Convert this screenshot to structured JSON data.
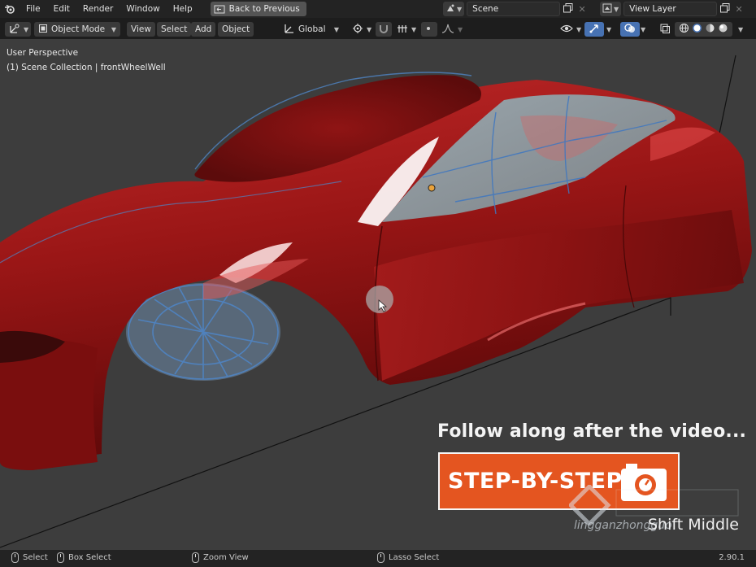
{
  "menu": {
    "items": [
      "File",
      "Edit",
      "Render",
      "Window",
      "Help"
    ],
    "back_button": "Back to Previous"
  },
  "scene": {
    "name": "Scene",
    "view_layer": "View Layer"
  },
  "header": {
    "mode": "Object Mode",
    "menus": [
      "View",
      "Select",
      "Add",
      "Object"
    ],
    "orientation": "Global"
  },
  "viewport": {
    "perspective": "User Perspective",
    "collection": "(1) Scene Collection | frontWheelWell"
  },
  "overlay": {
    "follow": "Follow along after the video...",
    "step": "STEP-BY-STEP",
    "shortcut": "Shift Middle",
    "watermark_text": "lingganzhongguo"
  },
  "status": {
    "select": "Select",
    "box_select": "Box Select",
    "zoom_view": "Zoom View",
    "lasso_select": "Lasso Select",
    "version": "2.90.1"
  },
  "colors": {
    "accent": "#e45520",
    "car_body": "#a61818",
    "ui_bg": "#232323",
    "viewport_bg": "#3d3d3d",
    "wire": "#5b8fc9"
  }
}
